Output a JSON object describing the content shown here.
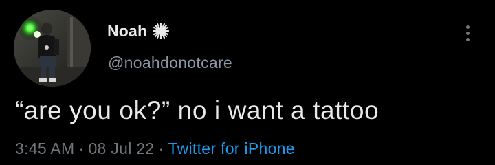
{
  "user": {
    "display_name": "Noah",
    "handle": "@noahdonotcare",
    "name_emoji_icon": "sparkle-star-icon"
  },
  "tweet": {
    "text": "“are you ok?” no i want a tattoo",
    "time": "3:45 AM",
    "separator": "·",
    "date": "08 Jul 22",
    "source": "Twitter for iPhone"
  },
  "icons": {
    "more": "more-vertical-icon"
  },
  "colors": {
    "background": "#000000",
    "text_primary": "#e7e9ea",
    "text_secondary": "#71767b",
    "link": "#1d9bf0",
    "avatar_green_light": "#4cff3a"
  }
}
